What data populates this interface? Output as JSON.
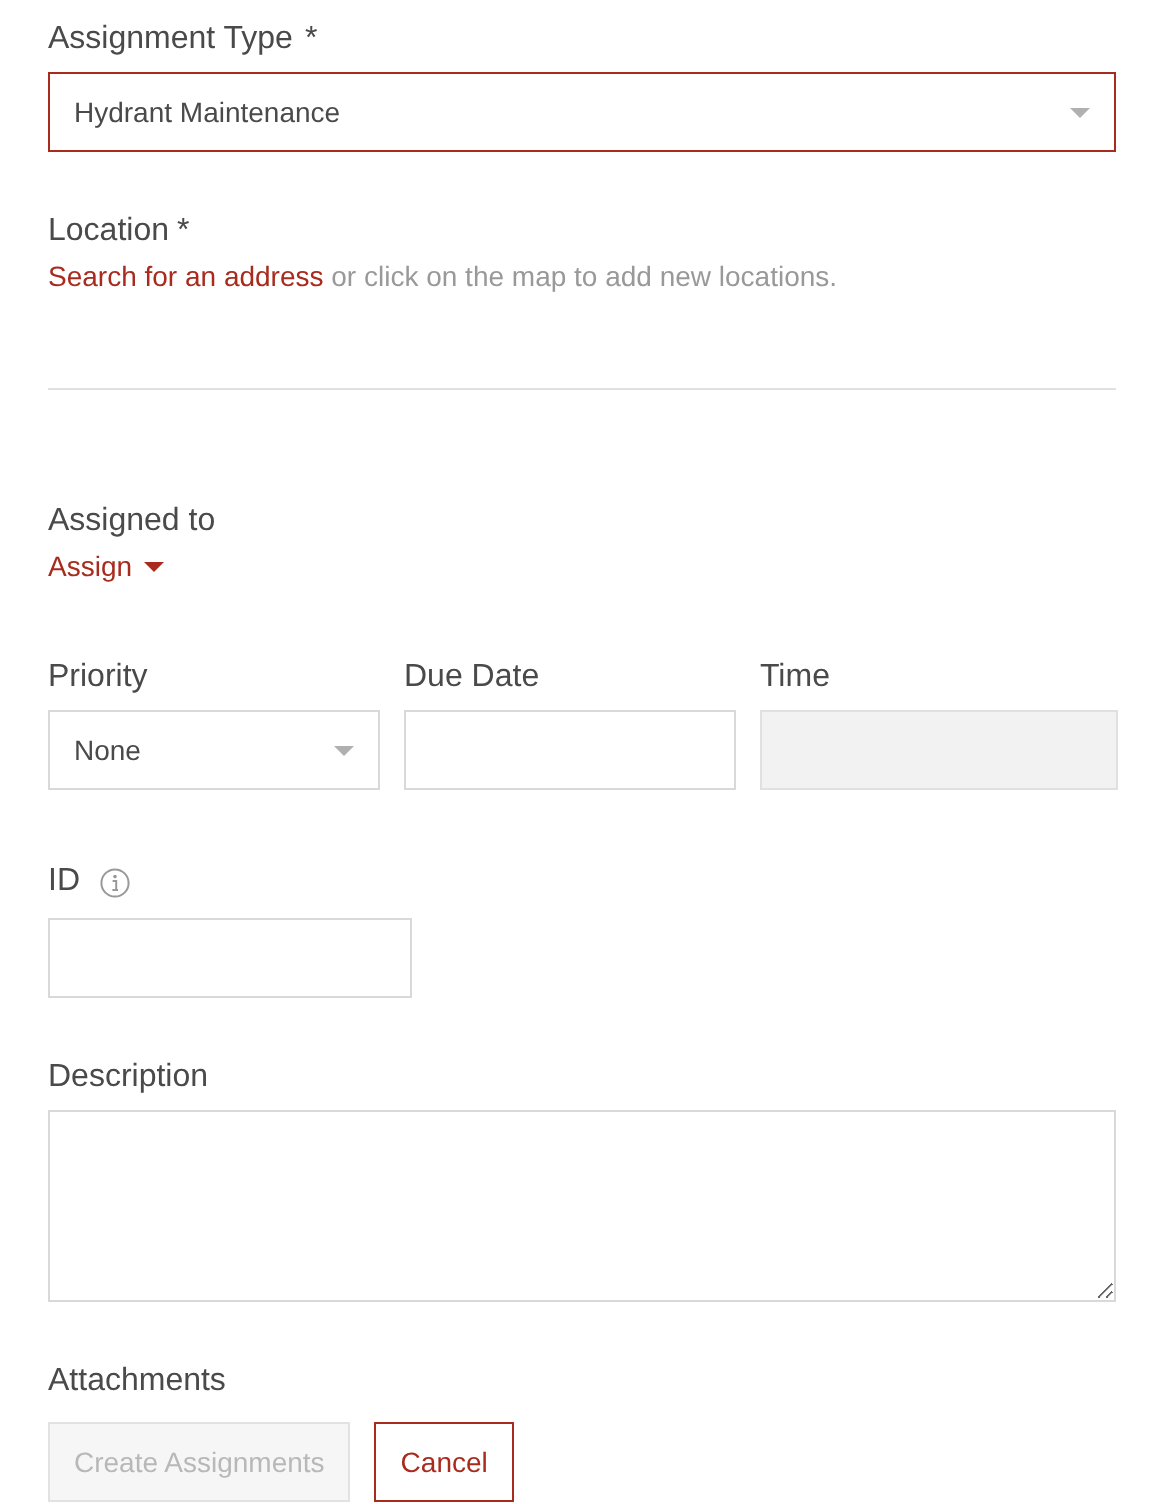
{
  "assignment_type": {
    "label": "Assignment Type",
    "required_mark": "*",
    "value": "Hydrant Maintenance",
    "invalid": true
  },
  "location": {
    "label": "Location",
    "required_mark": "*",
    "link": "Search for an address",
    "hint": "or click on the map to add new locations."
  },
  "assigned_to": {
    "label": "Assigned to",
    "link": "Assign"
  },
  "priority": {
    "label": "Priority",
    "value": "None"
  },
  "due_date": {
    "label": "Due Date"
  },
  "time": {
    "label": "Time",
    "disabled": true
  },
  "id": {
    "label": "ID"
  },
  "description": {
    "label": "Description"
  },
  "attachments": {
    "label": "Attachments"
  },
  "buttons": [
    {
      "label": "Create Assignments",
      "kind": "primary",
      "disabled": true
    },
    {
      "label": "Cancel",
      "kind": "secondary",
      "disabled": false
    }
  ]
}
